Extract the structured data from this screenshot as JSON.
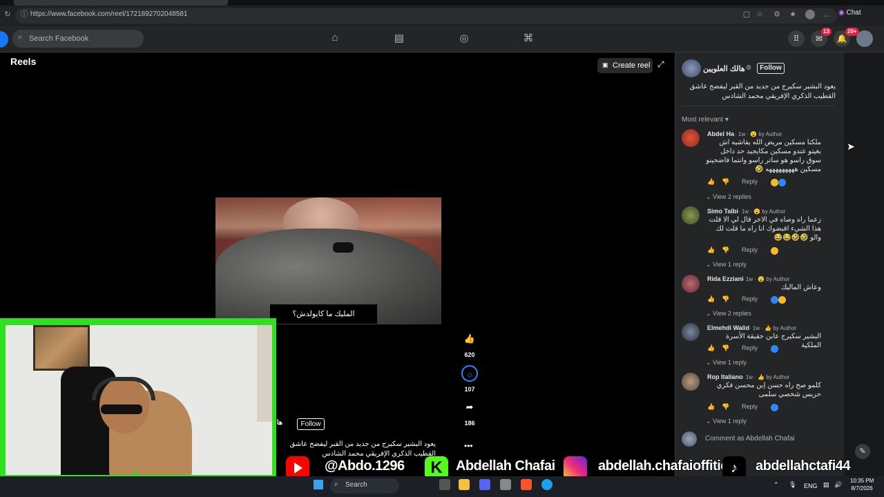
{
  "browser": {
    "url": "https://www.facebook.com/reel/1721892702048581",
    "chat_label": "Chat"
  },
  "facebook": {
    "search_placeholder": "Search Facebook",
    "messenger_badge": "13",
    "notifications_badge": "20+"
  },
  "reel": {
    "section_title": "Reels",
    "create_reel_label": "Create reel",
    "subtitle": "المليك ما كايولدش؟",
    "author": "هالا",
    "follow_label": "Follow",
    "caption": "يعود البشير سكيرج من جديد من القبر ليفضح  عاشق القطيب الذكري الإفريقي محمد الشاذس",
    "likes": "620",
    "comments": "107",
    "shares": "186"
  },
  "panel": {
    "author_name": "هالك العلويين",
    "follow_label": "Follow",
    "caption": "يعود البشير سكيرج من جديد من القبر ليفضح  عاشق القطيب الذكري الإفريقي محمد الشاذس",
    "sort_label": "Most relevant",
    "comment_placeholder": "Comment as Abdellah Chafai",
    "comments": [
      {
        "name": "Abdel Ha",
        "meta": "· 1w · 😮 by Author",
        "text": "ملكنا مسكين مريض الله يفاشيه اش بغيتو عندو مسكين مكايجيد حد داخل سوق راسو هو ساتر راسو وانتما فاضحينو مسكين هههههههههه 🤣",
        "reply_label": "Reply",
        "view_replies": "View 2 replies"
      },
      {
        "name": "Simo Talbi",
        "meta": "· 1w · 😮 by Author",
        "text": "زعما راه وصاه في الاخر قال لي الا قلت هذا الشيء اقبضوك انا راه ما قلت لك والو 🤣🤣😂😂",
        "reply_label": "Reply",
        "view_replies": "View 1 reply"
      },
      {
        "name": "Rida Ezziani",
        "meta": "· 1w · 😮 by Author",
        "text": "وعاش الماليك",
        "reply_label": "Reply",
        "view_replies": "View 2 replies"
      },
      {
        "name": "Elmehdi Walid",
        "meta": "· 1w · 👍 by Author",
        "text": "البشير سكيرج عابن حقيقة الأسرة الملكية",
        "reply_label": "Reply",
        "view_replies": "View 1 reply"
      },
      {
        "name": "Rop Italiano",
        "meta": "· 1w · 👍 by Author",
        "text": "كلمو صح راه حسن إبن محسن فكري حريس شخصي سلمى",
        "reply_label": "Reply",
        "view_replies": "View 1 reply"
      }
    ]
  },
  "overlay": {
    "youtube_handle": "@Abdo.1296",
    "kick_name": "Abdellah Chafai",
    "instagram_handle": "abdellah.chafaioffitid",
    "tiktok_handle": "abdellahctafi44"
  },
  "taskbar": {
    "search_label": "Search",
    "language": "ENG",
    "time": "10:35 PM",
    "date": "8/7/2026"
  },
  "colors": {
    "facebook_blue": "#1877f2",
    "overlay_green": "#2fe01e",
    "badge_red": "#e41e3f"
  }
}
